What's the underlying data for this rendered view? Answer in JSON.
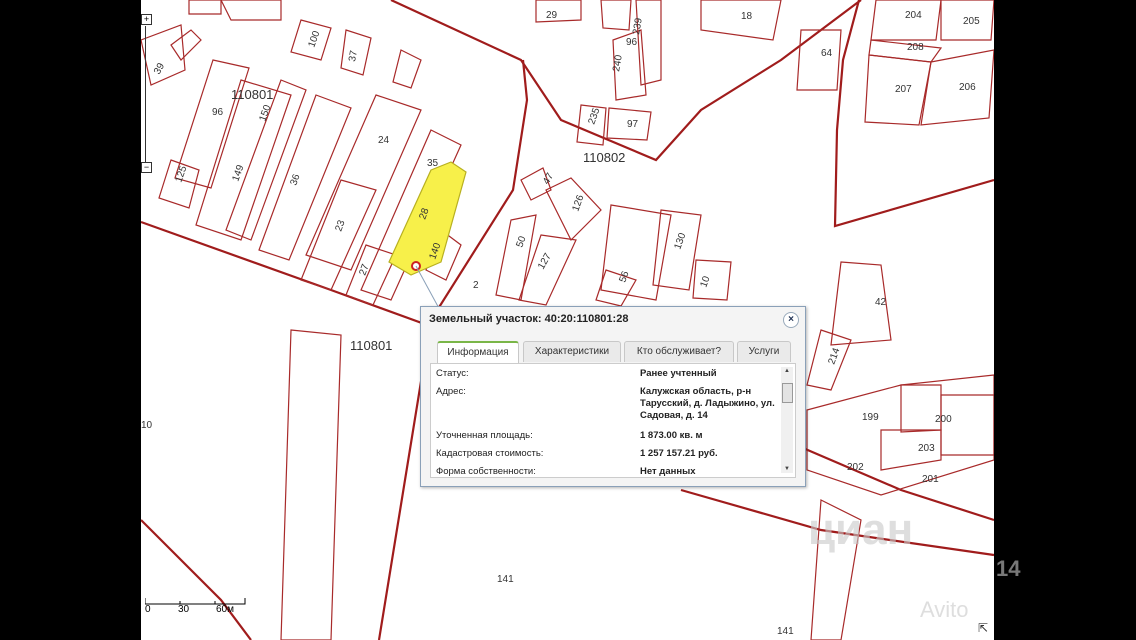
{
  "map": {
    "parcel_labels": [
      "29",
      "18",
      "204",
      "205",
      "100",
      "37",
      "96",
      "239",
      "240",
      "208",
      "64",
      "207",
      "206",
      "110801",
      "96",
      "150",
      "39",
      "235",
      "97",
      "24",
      "35",
      "125",
      "149",
      "36",
      "110802",
      "47",
      "126",
      "28",
      "23",
      "50",
      "130",
      "140",
      "27",
      "2",
      "127",
      "56",
      "10",
      "42",
      "110801",
      "214",
      "199",
      "200",
      "203",
      "202",
      "201",
      "141",
      "141",
      "10"
    ],
    "marker_color": "#cc2222",
    "highlight_color": "#f7f04a"
  },
  "zoom": {
    "plus_label": "+",
    "minus_label": "−"
  },
  "scale": {
    "labels": [
      "0",
      "30",
      "60м"
    ]
  },
  "popup": {
    "title": "Земельный участок: 40:20:110801:28",
    "close_icon": "×",
    "tabs": [
      {
        "label": "Информация",
        "active": true
      },
      {
        "label": "Характеристики",
        "active": false
      },
      {
        "label": "Кто обслуживает?",
        "active": false
      },
      {
        "label": "Услуги",
        "active": false
      }
    ],
    "rows": [
      {
        "label": "Статус:",
        "value": "Ранее учтенный"
      },
      {
        "label": "Адрес:",
        "value": "Калужская область, р-н Тарусский, д. Ладыжино, ул. Садовая, д. 14"
      },
      {
        "label": "Уточненная площадь:",
        "value": "1 873.00 кв. м"
      },
      {
        "label": "Кадастровая стоимость:",
        "value": "1 257 157.21 руб."
      },
      {
        "label": "Форма собственности:",
        "value": "Нет данных"
      }
    ]
  },
  "watermark": {
    "text1": "циан",
    "text2": "14",
    "text3": "Avito"
  },
  "resize_icon": "⇱"
}
